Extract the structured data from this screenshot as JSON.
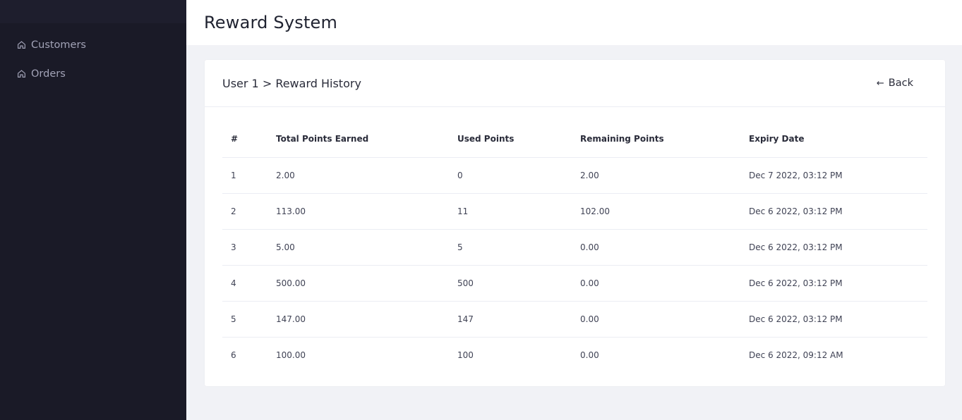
{
  "sidebar": {
    "items": [
      {
        "label": "Customers",
        "icon": "home-icon"
      },
      {
        "label": "Orders",
        "icon": "home-icon"
      }
    ]
  },
  "header": {
    "title": "Reward System"
  },
  "card": {
    "breadcrumb": "User 1 > Reward History",
    "back_label": "Back",
    "back_arrow": "←"
  },
  "table": {
    "columns": [
      "#",
      "Total Points Earned",
      "Used Points",
      "Remaining Points",
      "Expiry Date"
    ],
    "rows": [
      [
        "1",
        "2.00",
        "0",
        "2.00",
        "Dec 7 2022, 03:12 PM"
      ],
      [
        "2",
        "113.00",
        "11",
        "102.00",
        "Dec 6 2022, 03:12 PM"
      ],
      [
        "3",
        "5.00",
        "5",
        "0.00",
        "Dec 6 2022, 03:12 PM"
      ],
      [
        "4",
        "500.00",
        "500",
        "0.00",
        "Dec 6 2022, 03:12 PM"
      ],
      [
        "5",
        "147.00",
        "147",
        "0.00",
        "Dec 6 2022, 03:12 PM"
      ],
      [
        "6",
        "100.00",
        "100",
        "0.00",
        "Dec 6 2022, 09:12 AM"
      ]
    ]
  },
  "colors": {
    "sidebar_bg": "#1a1a27",
    "sidebar_text": "#a2a3b7",
    "page_bg": "#f1f2f6",
    "card_bg": "#ffffff"
  }
}
